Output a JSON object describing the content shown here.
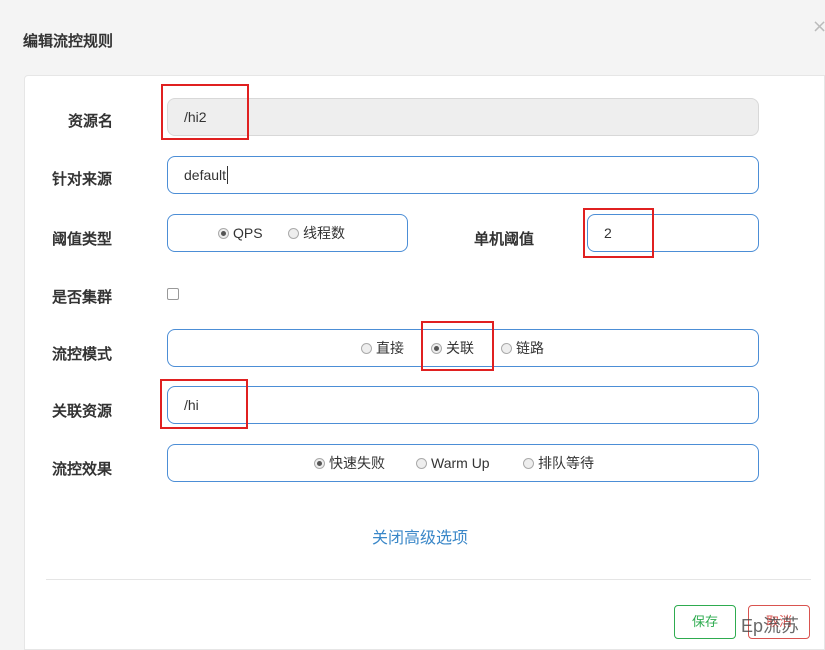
{
  "modal": {
    "title": "编辑流控规则",
    "close": "×"
  },
  "form": {
    "resource": {
      "label": "资源名",
      "value": "/hi2"
    },
    "limit_app": {
      "label": "针对来源",
      "value": "default"
    },
    "grade": {
      "label": "阈值类型",
      "options": [
        "QPS",
        "线程数"
      ],
      "selected": "QPS"
    },
    "count": {
      "label": "单机阈值",
      "value": "2"
    },
    "cluster": {
      "label": "是否集群",
      "checked": false
    },
    "strategy": {
      "label": "流控模式",
      "options": [
        "直接",
        "关联",
        "链路"
      ],
      "selected": "关联"
    },
    "ref_resource": {
      "label": "关联资源",
      "value": "/hi"
    },
    "control_behavior": {
      "label": "流控效果",
      "options": [
        "快速失败",
        "Warm Up",
        "排队等待"
      ],
      "selected": "快速失败"
    }
  },
  "advanced_link": "关闭高级选项",
  "footer": {
    "save_label": "保存",
    "cancel_label": "取消"
  },
  "watermark": "Ep流苏",
  "colors": {
    "input_border": "#4c8ed6",
    "highlight_red": "#e02020",
    "save_green": "#2eab4f",
    "cancel_red": "#d9534f",
    "link_blue": "#3a87c8"
  }
}
